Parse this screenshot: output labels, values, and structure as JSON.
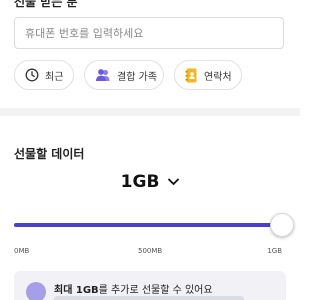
{
  "recipient": {
    "title": "선물 받는 분",
    "phone_placeholder": "휴대폰 번호를 입력하세요",
    "phone_value": ""
  },
  "quick_select": {
    "recent_label": "최근",
    "family_label": "결합 가족",
    "contacts_label": "연락처"
  },
  "gift_data": {
    "title": "선물할 데이터",
    "amount": "1GB",
    "slider": {
      "min_label": "0MB",
      "mid_label": "500MB",
      "max_label": "1GB",
      "value_fraction": 1.0
    }
  },
  "info": {
    "highlight": "최대 1GB",
    "text": "를 추가로 선물할 수 있어요"
  },
  "colors": {
    "accent": "#4a3fd1",
    "info_icon": "#a59ee8",
    "contacts_icon": "#f5b623",
    "family_icon": "#6a5ce0"
  }
}
